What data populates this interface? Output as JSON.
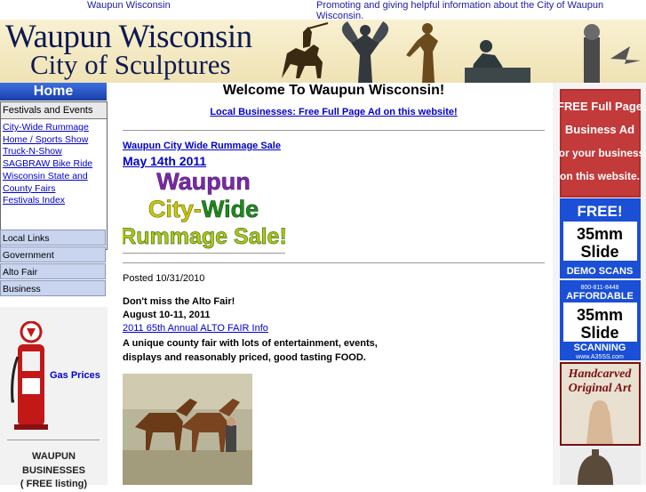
{
  "topbar": {
    "left_text": "Waupun Wisconsin",
    "right_text": "Promoting and giving helpful information about the City of Waupun Wisconsin."
  },
  "banner": {
    "title": "Waupun Wisconsin",
    "subtitle": "City of Sculptures"
  },
  "leftnav": {
    "home_label": "Home",
    "festivals_heading": "Festivals and Events",
    "festival_links": [
      "City-Wide Rummage",
      "Home / Sports Show",
      "Truck-N-Show",
      "SAGBRAW Bike Ride",
      "Wisconsin State and",
      "County Fairs",
      "Festivals Index"
    ],
    "items": [
      "Local Links",
      "Government",
      "Alto Fair",
      "Business"
    ],
    "gas_label": "Gas Prices",
    "businesses_lines": [
      "WAUPUN",
      "BUSINESSES",
      "( FREE listing)"
    ]
  },
  "main": {
    "welcome": "Welcome To Waupun Wisconsin!",
    "business_ad_link": "Local Businesses: Free Full Page Ad on this website!",
    "rummage_link": "Waupun City Wide Rummage Sale",
    "rummage_date": "May 14th 2011",
    "rummage_graphic": {
      "line1": "Waupun",
      "line2a": "City",
      "line2b": "-",
      "line2c": "Wide",
      "line3": "Rummage Sale!"
    },
    "posted": "Posted 10/31/2010",
    "alto_line1": "Don't miss the Alto Fair!",
    "alto_line2": "August 10-11, 2011",
    "alto_link": "2011 65th Annual ALTO FAIR Info",
    "alto_desc": "A unique county fair with lots of entertainment, events, displays and reasonably priced, good tasting FOOD."
  },
  "right_ads": {
    "ad1_lines": [
      "FREE Full Page",
      "Business Ad",
      "for your business",
      "on this website."
    ],
    "ad2": {
      "free": "FREE!",
      "size": "35mm",
      "slide": "Slide",
      "demo": "DEMO SCANS"
    },
    "ad3": {
      "phone": "800-811-8448",
      "afford": "AFFORDABLE",
      "size": "35mm",
      "slide": "Slide",
      "scan": "SCANNING",
      "url": "www.A35SS.com"
    },
    "ad4": {
      "line1": "Handcarved",
      "line2": "Original Art"
    }
  }
}
